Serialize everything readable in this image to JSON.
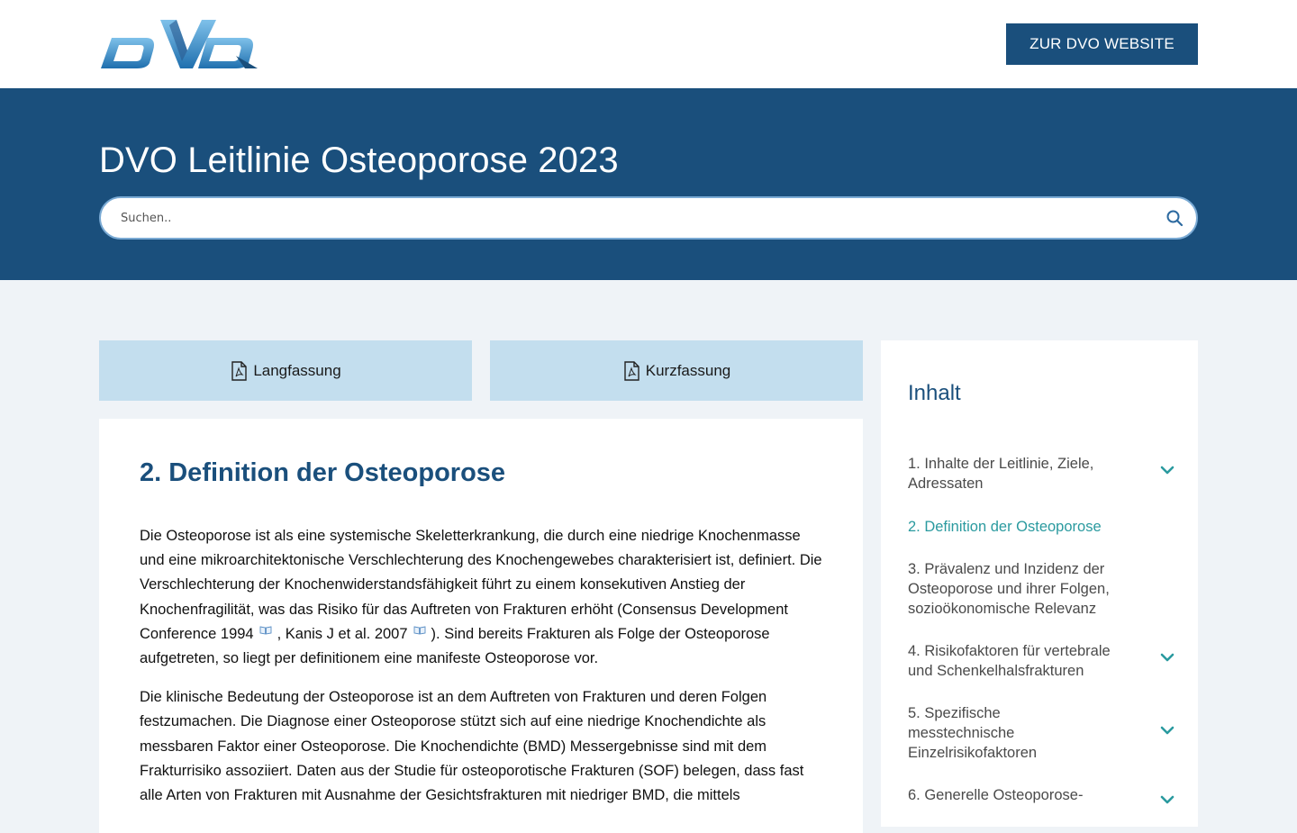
{
  "header": {
    "logo_text": "DVO",
    "site_button": "ZUR DVO WEBSITE"
  },
  "hero": {
    "title": "DVO Leitlinie Osteoporose 2023",
    "search_placeholder": "Suchen.."
  },
  "downloads": [
    {
      "label": "Langfassung",
      "icon": "pdf-icon"
    },
    {
      "label": "Kurzfassung",
      "icon": "pdf-icon"
    }
  ],
  "article": {
    "heading": "2. Definition der Osteoporose",
    "p1_a": "Die Osteoporose ist als eine systemische Skeletterkrankung, die durch eine niedrige Knochenmasse und eine mikroarchitektonische Verschlechterung des Knochengewebes charakterisiert ist, definiert. Die Verschlechterung der Knochenwiderstandsfähigkeit führt zu einem konsekutiven Anstieg der Knochenfragilität, was das Risiko für das Auftreten von Frakturen erhöht (Consensus Development Conference 1994",
    "p1_b": ", Kanis J et al. 2007",
    "p1_c": "). Sind bereits Frakturen als Folge der Osteoporose aufgetreten, so liegt per definitionem eine manifeste Osteoporose vor.",
    "p2": "Die klinische Bedeutung der Osteoporose ist an dem Auftreten von Frakturen und deren Folgen festzumachen. Die Diagnose einer Osteoporose stützt sich auf eine niedrige Knochendichte als messbaren Faktor einer Osteoporose. Die Knochendichte (BMD) Messergebnisse sind mit dem Frakturrisiko assoziiert. Daten aus der Studie für osteoporotische Frakturen (SOF) belegen, dass fast alle Arten von Frakturen mit Ausnahme der Gesichtsfrakturen mit niedriger BMD, die mittels"
  },
  "toc": {
    "title": "Inhalt",
    "items": [
      {
        "label": "1. Inhalte der Leitlinie, Ziele, Adressaten",
        "expandable": true,
        "active": false
      },
      {
        "label": "2. Definition der Osteoporose",
        "expandable": false,
        "active": true
      },
      {
        "label": "3. Prävalenz und Inzidenz der Osteoporose und ihrer Folgen, sozioökonomische Relevanz",
        "expandable": false,
        "active": false
      },
      {
        "label": "4. Risikofaktoren für vertebrale und Schenkelhalsfrakturen",
        "expandable": true,
        "active": false
      },
      {
        "label": "5. Spezifische messtechnische Einzelrisikofaktoren",
        "expandable": true,
        "active": false
      },
      {
        "label": "6. Generelle Osteoporose-",
        "expandable": true,
        "active": false
      }
    ]
  },
  "colors": {
    "brand_blue": "#1a4f7c",
    "accent_teal": "#2a9a9f",
    "download_bg": "#c3deee",
    "page_bg": "#eff3f7"
  }
}
